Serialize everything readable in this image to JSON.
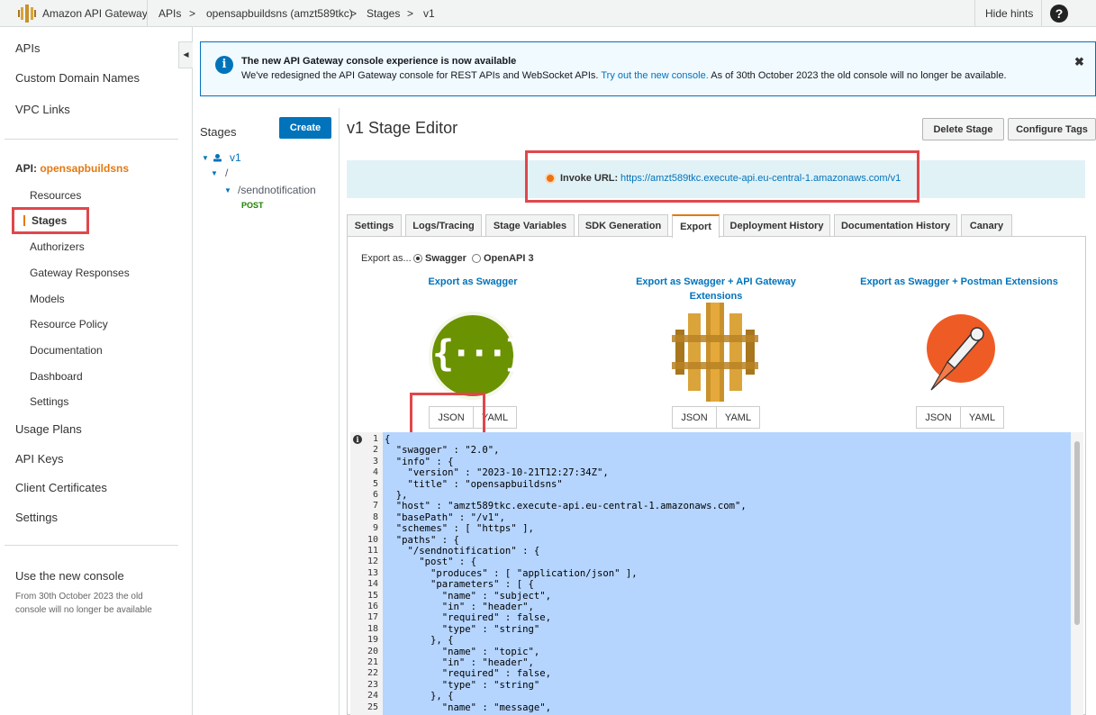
{
  "topbar": {
    "brand": "Amazon API Gateway",
    "breadcrumb": [
      "APIs",
      ">",
      "opensapbuildsns (amzt589tkc)",
      ">",
      "Stages",
      ">",
      "v1"
    ],
    "hide_hints": "Hide hints",
    "help_label": "?"
  },
  "sidebar": {
    "top_items": [
      "APIs",
      "Custom Domain Names",
      "VPC Links"
    ],
    "api_prefix": "API:",
    "api_name": "opensapbuildsns",
    "api_items": [
      "Resources",
      "Stages",
      "Authorizers",
      "Gateway Responses",
      "Models",
      "Resource Policy",
      "Documentation",
      "Dashboard",
      "Settings"
    ],
    "bottom_items": [
      "Usage Plans",
      "API Keys",
      "Client Certificates",
      "Settings"
    ],
    "new_console_title": "Use the new console",
    "new_console_text": "From 30th October 2023 the old console will no longer be available",
    "collapse_glyph": "◀"
  },
  "banner": {
    "icon": "i",
    "title": "The new API Gateway console experience is now available",
    "text_before": "We've redesigned the API Gateway console for REST APIs and WebSocket APIs.",
    "link": "Try out the new console.",
    "text_after": "As of 30th October 2023 the old console will no longer be available.",
    "close": "✖"
  },
  "stages_panel": {
    "title": "Stages",
    "create_label": "Create",
    "tree": {
      "stage": "v1",
      "root": "/",
      "resource": "/sendnotification",
      "method": "POST"
    }
  },
  "editor": {
    "title": "v1 Stage Editor",
    "delete_label": "Delete Stage",
    "tags_label": "Configure Tags",
    "invoke_label": "Invoke URL:",
    "invoke_url": "https://amzt589tkc.execute-api.eu-central-1.amazonaws.com/v1",
    "tabs": [
      "Settings",
      "Logs/Tracing",
      "Stage Variables",
      "SDK Generation",
      "Export",
      "Deployment History",
      "Documentation History",
      "Canary"
    ],
    "active_tab": "Export"
  },
  "export": {
    "export_as": "Export as...",
    "options": [
      "Swagger",
      "OpenAPI 3"
    ],
    "selected_option": "Swagger",
    "swagger_link": "Export as Swagger",
    "apigw_link_line1": "Export as Swagger + API Gateway",
    "apigw_link_line2": "Extensions",
    "postman_link": "Export as Swagger + Postman Extensions",
    "json_label": "JSON",
    "yaml_label": "YAML",
    "swagger_glyph": "{···}"
  },
  "code": {
    "gutter_icon": "i",
    "line_numbers": [
      "1",
      "2",
      "3",
      "4",
      "5",
      "6",
      "7",
      "8",
      "9",
      "10",
      "11",
      "12",
      "13",
      "14",
      "15",
      "16",
      "17",
      "18",
      "19",
      "20",
      "21",
      "22",
      "23",
      "24",
      "25"
    ],
    "lines": [
      "{",
      "  \"swagger\" : \"2.0\",",
      "  \"info\" : {",
      "    \"version\" : \"2023-10-21T12:27:34Z\",",
      "    \"title\" : \"opensapbuildsns\"",
      "  },",
      "  \"host\" : \"amzt589tkc.execute-api.eu-central-1.amazonaws.com\",",
      "  \"basePath\" : \"/v1\",",
      "  \"schemes\" : [ \"https\" ],",
      "  \"paths\" : {",
      "    \"/sendnotification\" : {",
      "      \"post\" : {",
      "        \"produces\" : [ \"application/json\" ],",
      "        \"parameters\" : [ {",
      "          \"name\" : \"subject\",",
      "          \"in\" : \"header\",",
      "          \"required\" : false,",
      "          \"type\" : \"string\"",
      "        }, {",
      "          \"name\" : \"topic\",",
      "          \"in\" : \"header\",",
      "          \"required\" : false,",
      "          \"type\" : \"string\"",
      "        }, {",
      "          \"name\" : \"message\","
    ]
  }
}
